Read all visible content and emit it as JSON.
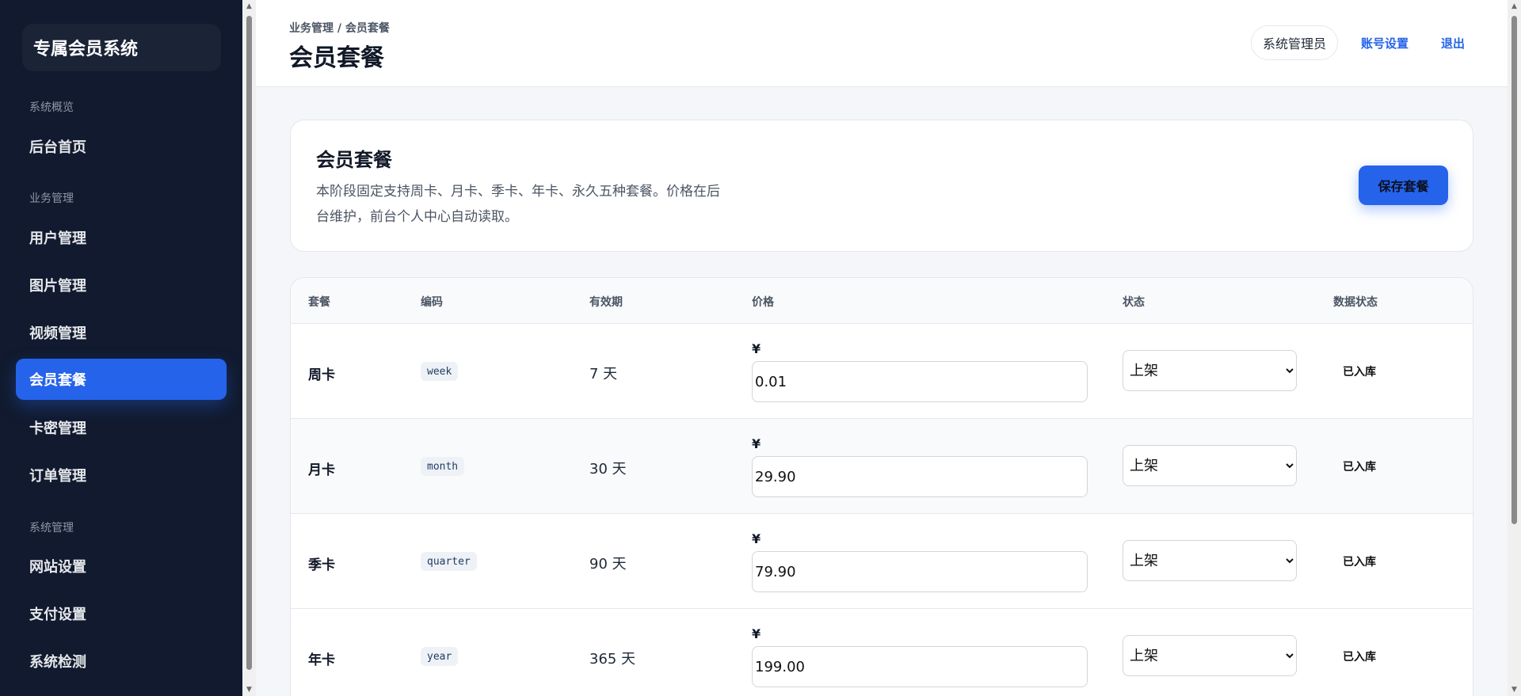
{
  "sidebar": {
    "brand": "专属会员系统",
    "groups": [
      "系统概览",
      "业务管理",
      "系统管理"
    ],
    "items": [
      "后台首页",
      "用户管理",
      "图片管理",
      "视频管理",
      "会员套餐",
      "卡密管理",
      "订单管理",
      "网站设置",
      "支付设置",
      "系统检测"
    ]
  },
  "header": {
    "breadcrumb": "业务管理 / 会员套餐",
    "title": "会员套餐",
    "admin": "系统管理员",
    "account": "账号设置",
    "logout": "退出"
  },
  "intro": {
    "title": "会员套餐",
    "desc": "本阶段固定支持周卡、月卡、季卡、年卡、永久五种套餐。价格在后台维护，前台个人中心自动读取。",
    "save": "保存套餐"
  },
  "table": {
    "columns": [
      "套餐",
      "编码",
      "有效期",
      "价格",
      "状态",
      "数据状态"
    ],
    "currency": "¥",
    "rows": [
      {
        "name": "周卡",
        "code": "week",
        "duration": "7 天",
        "price": "0.01",
        "status": "上架",
        "db": "已入库"
      },
      {
        "name": "月卡",
        "code": "month",
        "duration": "30 天",
        "price": "29.90",
        "status": "上架",
        "db": "已入库"
      },
      {
        "name": "季卡",
        "code": "quarter",
        "duration": "90 天",
        "price": "79.90",
        "status": "上架",
        "db": "已入库"
      },
      {
        "name": "年卡",
        "code": "year",
        "duration": "365 天",
        "price": "199.00",
        "status": "上架",
        "db": "已入库"
      }
    ]
  }
}
